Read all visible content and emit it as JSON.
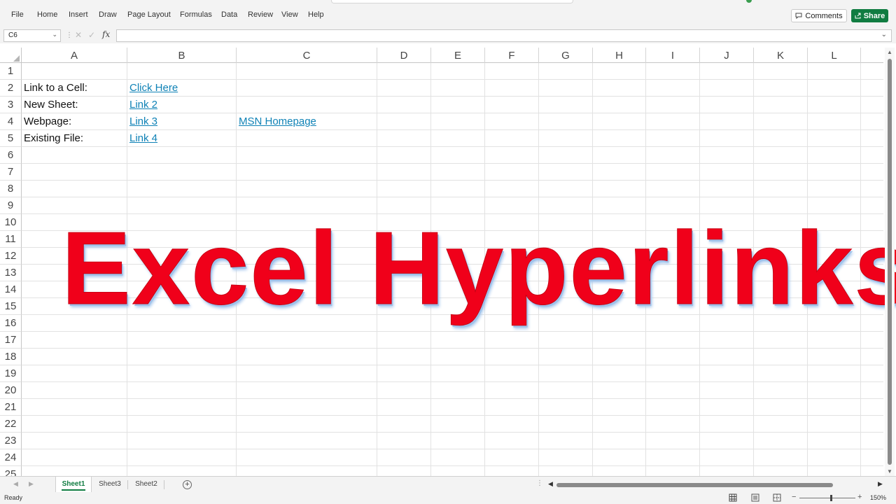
{
  "menu": {
    "items": [
      "File",
      "Home",
      "Insert",
      "Draw",
      "Page Layout",
      "Formulas",
      "Data",
      "Review",
      "View",
      "Help"
    ],
    "comments_label": "Comments",
    "share_label": "Share"
  },
  "formula_bar": {
    "name_box": "C6",
    "fx_label": "fx",
    "formula": ""
  },
  "grid": {
    "columns": [
      "A",
      "B",
      "C",
      "D",
      "E",
      "F",
      "G",
      "H",
      "I",
      "J",
      "K",
      "L"
    ],
    "rows": [
      "1",
      "2",
      "3",
      "4",
      "5",
      "6",
      "7",
      "8",
      "9",
      "10",
      "11",
      "12",
      "13",
      "14",
      "15",
      "16",
      "17",
      "18",
      "19",
      "20",
      "21",
      "22",
      "23",
      "24",
      "25"
    ],
    "cells": {
      "A2": "Link to a Cell:",
      "A3": "New Sheet:",
      "A4": "Webpage:",
      "A5": "Existing File:",
      "B2": "Click Here",
      "B3": "Link 2",
      "B4": "Link 3",
      "B5": "Link 4",
      "C4": "MSN Homepage"
    }
  },
  "overlay": {
    "title": "Excel Hyperlinks",
    "color": "#f0001a"
  },
  "sheet_tabs": {
    "tabs": [
      "Sheet1",
      "Sheet3",
      "Sheet2"
    ],
    "active": "Sheet1"
  },
  "status": {
    "ready": "Ready",
    "zoom": "150%"
  },
  "colors": {
    "accent": "#107c41",
    "hyperlink": "#0f82b6"
  }
}
